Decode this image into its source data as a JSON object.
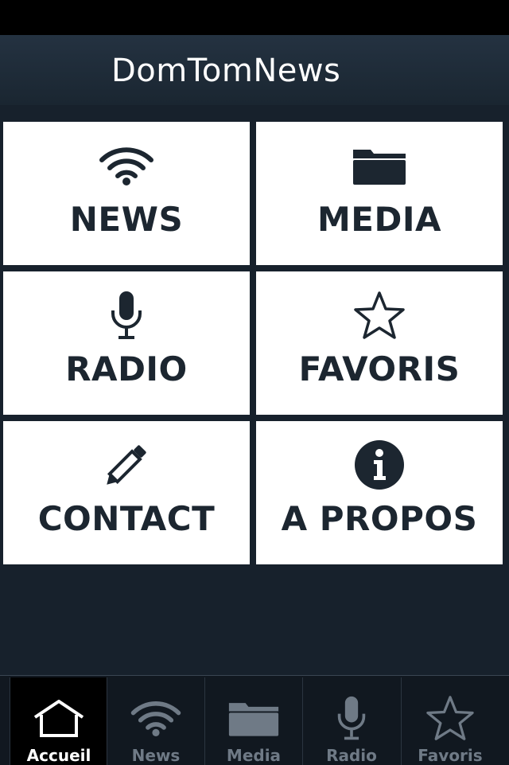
{
  "app": {
    "title": "DomTomNews"
  },
  "colors": {
    "tile_bg": "#ffffff",
    "tile_text": "#1c2630",
    "background": "#17212c",
    "tab_active": "#ffffff",
    "tab_inactive": "#6f7a86"
  },
  "tiles": [
    {
      "label": "NEWS",
      "icon": "wifi-icon"
    },
    {
      "label": "MEDIA",
      "icon": "folder-icon"
    },
    {
      "label": "RADIO",
      "icon": "microphone-icon"
    },
    {
      "label": "FAVORIS",
      "icon": "star-icon"
    },
    {
      "label": "CONTACT",
      "icon": "pencil-icon"
    },
    {
      "label": "A PROPOS",
      "icon": "info-icon"
    }
  ],
  "tabbar": {
    "selected": "Accueil",
    "items": [
      {
        "label": "Accueil",
        "icon": "home-icon"
      },
      {
        "label": "News",
        "icon": "wifi-icon"
      },
      {
        "label": "Media",
        "icon": "folder-icon"
      },
      {
        "label": "Radio",
        "icon": "microphone-icon"
      },
      {
        "label": "Favoris",
        "icon": "star-icon"
      }
    ]
  }
}
